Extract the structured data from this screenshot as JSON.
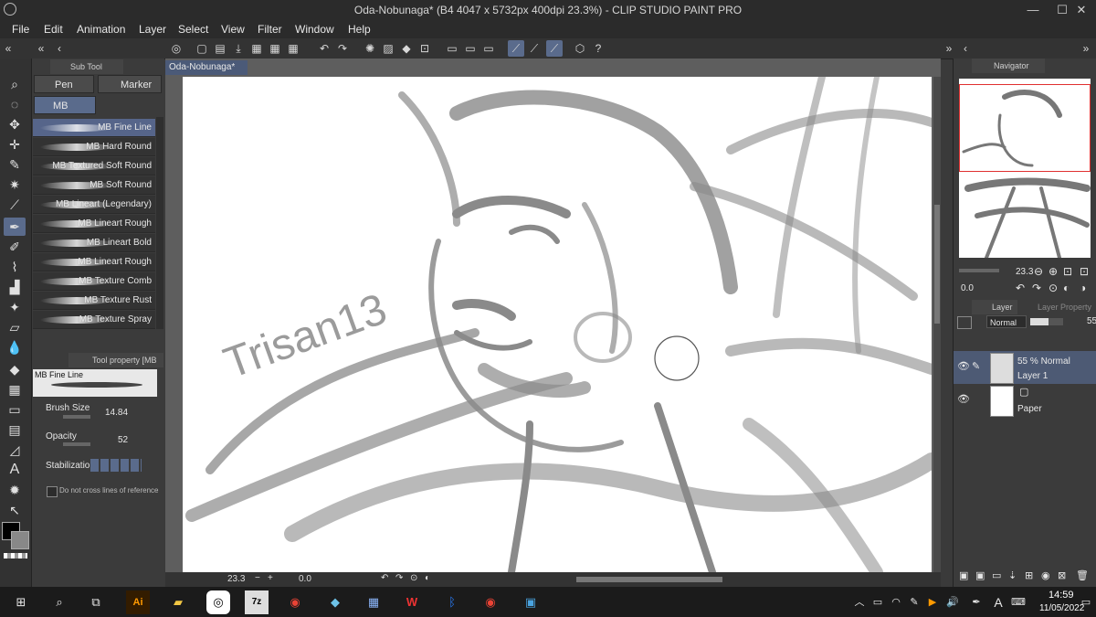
{
  "window": {
    "title": "Oda-Nobunaga* (B4 4047 x 5732px 400dpi 23.3%)  - CLIP STUDIO PAINT PRO",
    "controls": {
      "minimize": "—",
      "maximize": "☐",
      "close": "✕"
    }
  },
  "menu": [
    "File",
    "Edit",
    "Animation",
    "Layer",
    "Select",
    "View",
    "Filter",
    "Window",
    "Help"
  ],
  "subtool": {
    "panel_title": "Sub Tool [Pen]",
    "group_buttons": [
      "Pen",
      "Marker"
    ],
    "set_button": "MB Starter",
    "brushes": [
      "MB Fine Line",
      "MB Hard Round",
      "MB Textured Soft Round",
      "MB Soft Round",
      "MB Lineart (Legendary)",
      "MB Lineart Rough",
      "MB Lineart Bold",
      "MB Lineart Rough",
      "MB Texture Comb",
      "MB Texture Rust",
      "MB Texture Spray"
    ]
  },
  "tool_property": {
    "panel_title": "Tool property [MB",
    "current_brush": "MB Fine Line",
    "brush_size_label": "Brush Size",
    "brush_size_value": "14.84",
    "opacity_label": "Opacity",
    "opacity_value": "52",
    "stabilization_label": "Stabilization",
    "checkbox_label": "Do not cross lines of reference"
  },
  "document": {
    "tab_label": "Oda-Nobunaga*",
    "zoom": "23.3",
    "rotation": "0.0",
    "signature": "Trisan13"
  },
  "navigator": {
    "title": "Navigator",
    "zoom": "23.3",
    "rotation": "0.0"
  },
  "layers": {
    "tab_label": "Layer",
    "tab2_label": "Layer Property",
    "blend_mode": "Normal",
    "opacity": "55",
    "items": [
      {
        "info": "55 % Normal",
        "name": "Layer 1"
      },
      {
        "info": "",
        "name": "Paper"
      }
    ]
  },
  "taskbar": {
    "time": "14:59",
    "date": "11/05/2022",
    "ime": "A"
  },
  "colors": {
    "accent": "#5a6b8c",
    "canvas_bg": "#5e5e5e",
    "navigator_frame": "#e03030"
  }
}
